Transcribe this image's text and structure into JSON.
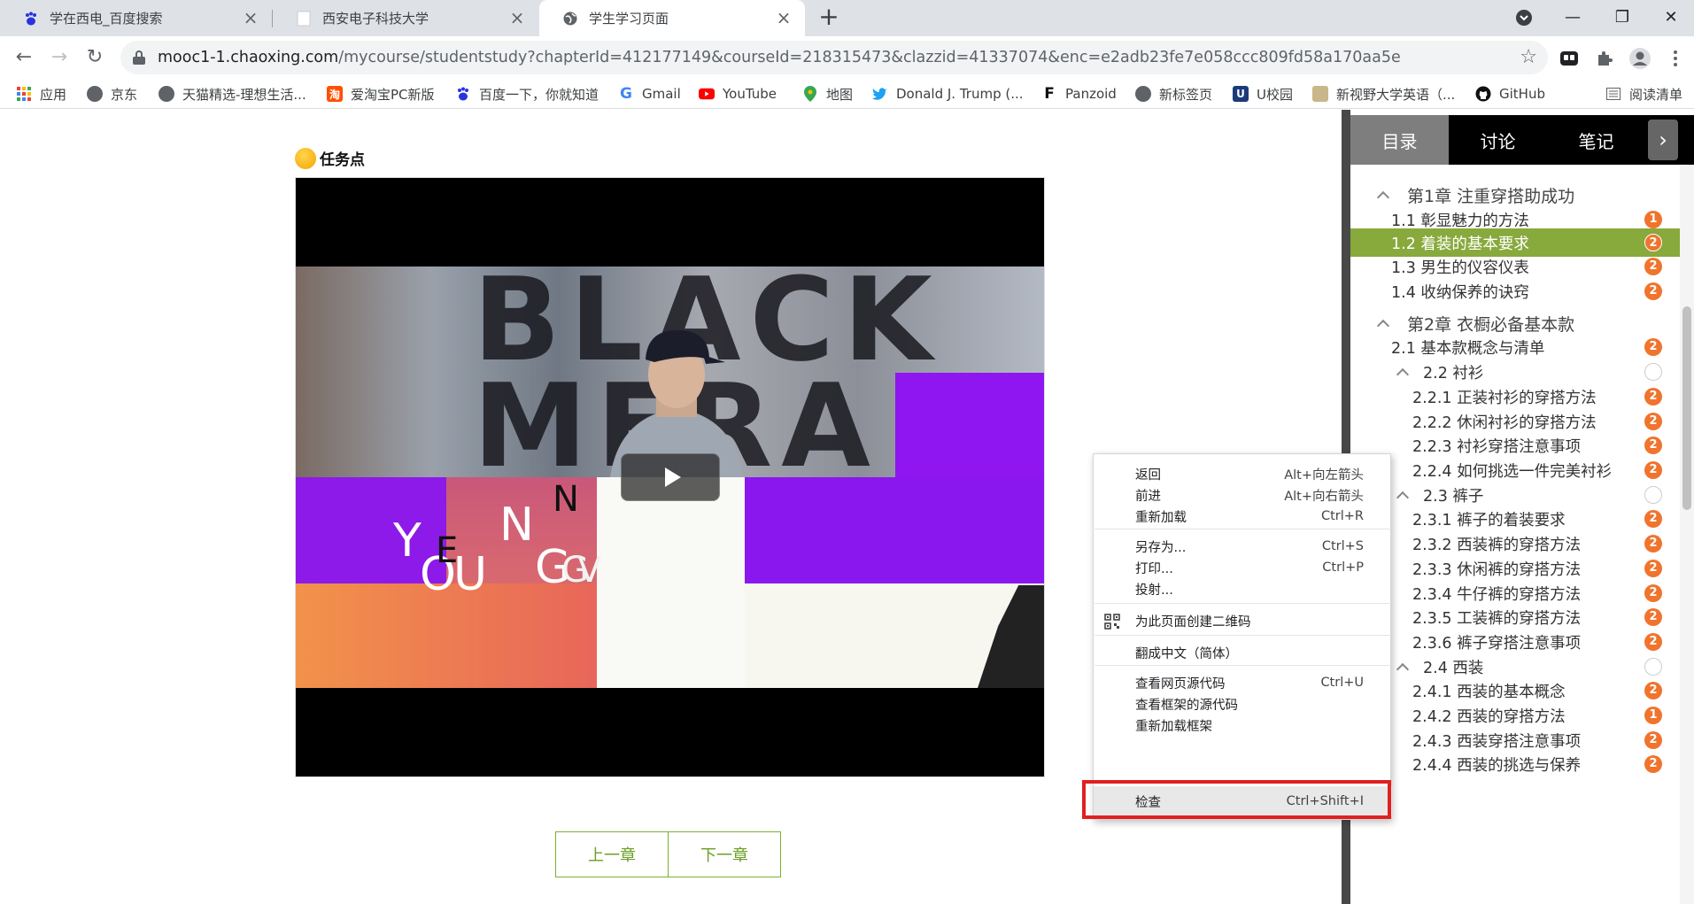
{
  "browser": {
    "tabs": [
      {
        "title": "学在西电_百度搜索",
        "icon": "baidu-paw-icon",
        "active": false
      },
      {
        "title": "西安电子科技大学",
        "icon": "blank-page-icon",
        "active": false
      },
      {
        "title": "学生学习页面",
        "icon": "globe-icon",
        "active": true
      }
    ],
    "new_tab": "+",
    "url": {
      "host": "mooc1-1.chaoxing.com",
      "path": "/mycourse/studentstudy?chapterId=412177149&courseId=218315473&clazzid=41337074&enc=e2adb23fe7e058ccc809fd58a170aa5e"
    },
    "bookmarks": [
      {
        "label": "应用",
        "icon": "apps-grid-icon",
        "color": "#ea4335"
      },
      {
        "label": "京东",
        "icon": "globe-icon",
        "color": "#5f6368"
      },
      {
        "label": "天猫精选-理想生活...",
        "icon": "globe-icon",
        "color": "#5f6368"
      },
      {
        "label": "爱淘宝PC新版",
        "icon": "taobao-icon",
        "color": "#ff5000"
      },
      {
        "label": "百度一下，你就知道",
        "icon": "baidu-paw-icon",
        "color": "#2932e1"
      },
      {
        "label": "Gmail",
        "icon": "google-g-icon",
        "color": "#4285f4"
      },
      {
        "label": "YouTube",
        "icon": "youtube-icon",
        "color": "#ff0000"
      },
      {
        "label": "地图",
        "icon": "maps-pin-icon",
        "color": "#34a853"
      },
      {
        "label": "Donald J. Trump (...",
        "icon": "twitter-bird-icon",
        "color": "#1da1f2"
      },
      {
        "label": "Panzoid",
        "icon": "panzoid-icon",
        "color": "#111111"
      },
      {
        "label": "新标签页",
        "icon": "globe-icon",
        "color": "#5f6368"
      },
      {
        "label": "U校园",
        "icon": "u-campus-icon",
        "color": "#1a3a7a"
      },
      {
        "label": "新视野大学英语（...",
        "icon": "picture-icon",
        "color": "#8a6d3b"
      },
      {
        "label": "GitHub",
        "icon": "github-icon",
        "color": "#111111"
      }
    ],
    "reading_list": "阅读清单"
  },
  "page": {
    "task_point": "任务点",
    "prev_chapter": "上一章",
    "next_chapter": "下一章"
  },
  "sidebar": {
    "tabs": [
      "目录",
      "讨论",
      "笔记"
    ],
    "active_tab": "目录",
    "toc": [
      {
        "text": "第1章 注重穿搭助成功",
        "level": "chapter",
        "caret": true,
        "badge": ""
      },
      {
        "text": "1.1 彰显魅力的方法",
        "level": 1,
        "badge": "1"
      },
      {
        "text": "1.2 着装的基本要求",
        "level": 1,
        "badge": "2",
        "active": true
      },
      {
        "text": "1.3 男生的仪容仪表",
        "level": 1,
        "badge": "2"
      },
      {
        "text": "1.4 收纳保养的诀窍",
        "level": 1,
        "badge": "2"
      },
      {
        "text": "第2章 衣橱必备基本款",
        "level": "chapter",
        "caret": true,
        "badge": ""
      },
      {
        "text": "2.1 基本款概念与清单",
        "level": 1,
        "badge": "2"
      },
      {
        "text": "2.2 衬衫",
        "level": "section",
        "caret": true,
        "badge": "empty"
      },
      {
        "text": "2.2.1 正装衬衫的穿搭方法",
        "level": 2,
        "badge": "2"
      },
      {
        "text": "2.2.2 休闲衬衫的穿搭方法",
        "level": 2,
        "badge": "2"
      },
      {
        "text": "2.2.3 衬衫穿搭注意事项",
        "level": 2,
        "badge": "2"
      },
      {
        "text": "2.2.4 如何挑选一件完美衬衫",
        "level": 2,
        "badge": "2"
      },
      {
        "text": "2.3 裤子",
        "level": "section",
        "caret": true,
        "badge": "empty"
      },
      {
        "text": "2.3.1 裤子的着装要求",
        "level": 2,
        "badge": "2"
      },
      {
        "text": "2.3.2 西装裤的穿搭方法",
        "level": 2,
        "badge": "2"
      },
      {
        "text": "2.3.3 休闲裤的穿搭方法",
        "level": 2,
        "badge": "2"
      },
      {
        "text": "2.3.4 牛仔裤的穿搭方法",
        "level": 2,
        "badge": "2"
      },
      {
        "text": "2.3.5 工装裤的穿搭方法",
        "level": 2,
        "badge": "2"
      },
      {
        "text": "2.3.6 裤子穿搭注意事项",
        "level": 2,
        "badge": "2"
      },
      {
        "text": "2.4 西装",
        "level": "section",
        "caret": true,
        "badge": "empty"
      },
      {
        "text": "2.4.1 西装的基本概念",
        "level": 2,
        "badge": "2"
      },
      {
        "text": "2.4.2 西装的穿搭方法",
        "level": 2,
        "badge": "1"
      },
      {
        "text": "2.4.3 西装穿搭注意事项",
        "level": 2,
        "badge": "2"
      },
      {
        "text": "2.4.4 西装的挑选与保养",
        "level": 2,
        "badge": "2"
      }
    ]
  },
  "context_menu": {
    "items": [
      {
        "label": "返回",
        "shortcut": "Alt+向左箭头"
      },
      {
        "label": "前进",
        "shortcut": "Alt+向右箭头"
      },
      {
        "label": "重新加载",
        "shortcut": "Ctrl+R"
      },
      {
        "label": "另存为...",
        "shortcut": "Ctrl+S"
      },
      {
        "label": "打印...",
        "shortcut": "Ctrl+P"
      },
      {
        "label": "投射...",
        "shortcut": ""
      },
      {
        "label": "为此页面创建二维码",
        "shortcut": "",
        "icon": "qr-code-icon"
      },
      {
        "label": "翻成中文（简体）",
        "shortcut": ""
      },
      {
        "label": "查看网页源代码",
        "shortcut": "Ctrl+U"
      },
      {
        "label": "查看框架的源代码",
        "shortcut": ""
      },
      {
        "label": "重新加载框架",
        "shortcut": ""
      },
      {
        "label": "检查",
        "shortcut": "Ctrl+Shift+I",
        "highlighted": true
      }
    ]
  },
  "video": {
    "graffiti_text": "BLACK MERA",
    "letters": [
      "Y",
      "O",
      "U",
      "N",
      "G",
      "E",
      "N",
      "G",
      "V"
    ]
  },
  "colors": {
    "accent_green": "#88a93c",
    "badge_orange": "#f0742d",
    "highlight_red": "#e02020",
    "purple": "#8f16f0"
  }
}
